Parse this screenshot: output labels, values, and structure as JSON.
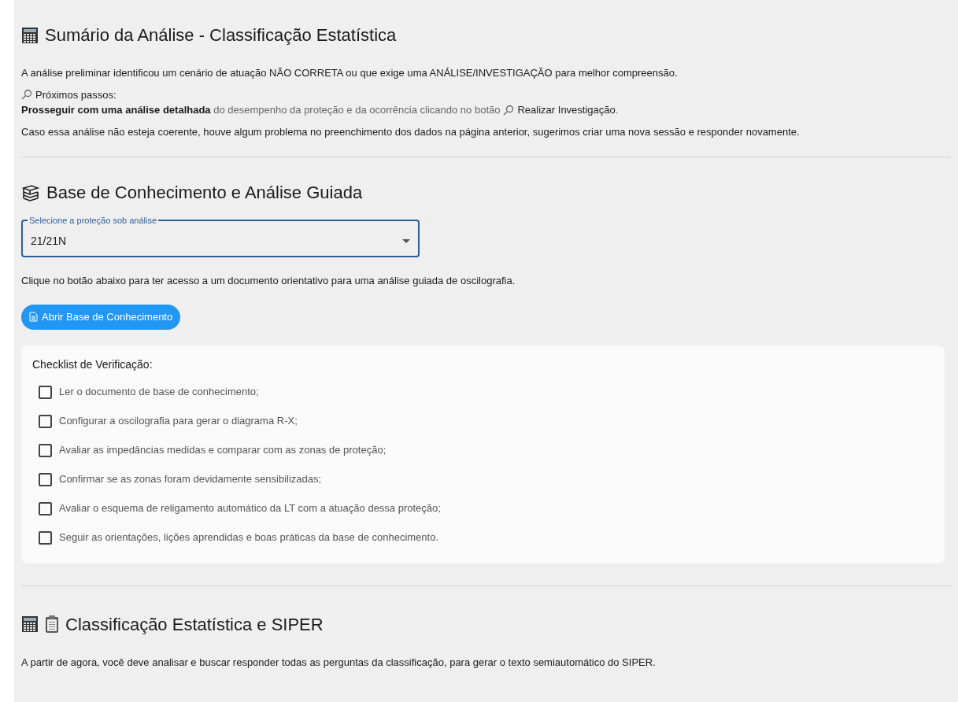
{
  "summary": {
    "title": "Sumário da Análise - Classificação Estatística",
    "intro": "A análise preliminar identificou um cenário de atuação NÃO CORRETA ou que exige uma ANÁLISE/INVESTIGAÇÃO para melhor compreensão.",
    "next_steps_label": "Próximos passos:",
    "next_steps_text": "**Prosseguir com uma análise detalhada** do desempenho da proteção e da ocorrência clicando no botão",
    "next_steps_action": "Realizar Investigação",
    "next_steps_end": ".",
    "note": "Caso essa análise não esteja coerente, houve algum problema no preenchimento dos dados na página anterior, sugerimos criar uma nova sessão e responder novamente."
  },
  "knowledge": {
    "title": "Base de Conhecimento e Análise Guiada",
    "select": {
      "label": "Selecione a proteção sob análise",
      "value": "21/21N"
    },
    "hint": "Clique no botão abaixo para ter acesso a um documento orientativo para uma análise guiada de oscilografia.",
    "button": "Abrir Base de Conhecimento",
    "checklist": {
      "title": "Checklist de Verificação:",
      "items": [
        {
          "label": "Ler o documento de base de conhecimento;",
          "checked": false
        },
        {
          "label": "Configurar a oscilografia para gerar o diagrama R-X;",
          "checked": false
        },
        {
          "label": "Avaliar as impedâncias medidas e comparar com as zonas de proteção;",
          "checked": false
        },
        {
          "label": "Confirmar se as zonas foram devidamente sensibilizadas;",
          "checked": false
        },
        {
          "label": "Avaliar o esquema de religamento automático da LT com a atuação dessa proteção;",
          "checked": false
        },
        {
          "label": "Seguir as orientações, lições aprendidas e boas práticas da base de conhecimento.",
          "checked": false
        }
      ]
    }
  },
  "classification": {
    "title": "Classificação Estatística e SIPER",
    "text": "A partir de agora, você deve analisar e buscar responder todas as perguntas da classificação, para gerar o texto semiautomático do SIPER."
  }
}
